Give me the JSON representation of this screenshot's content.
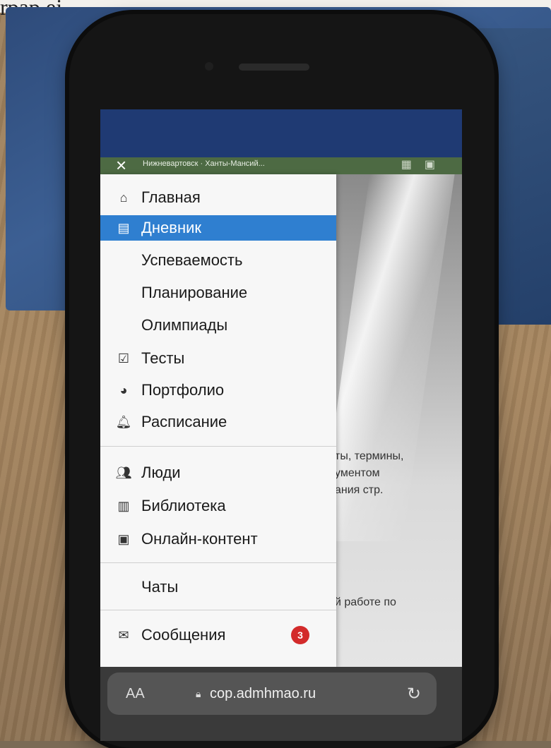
{
  "paper": {
    "text": "rpap ej"
  },
  "site_bar": {
    "title": "Нижневартовск · Ханты-Мансий..."
  },
  "menu": {
    "items": [
      {
        "label": "Главная",
        "icon": "home-icon"
      },
      {
        "label": "Дневник",
        "icon": "diary-icon",
        "active": true
      },
      {
        "label": "Успеваемость"
      },
      {
        "label": "Планирование"
      },
      {
        "label": "Олимпиады"
      },
      {
        "label": "Тесты",
        "icon": "checkbox-icon"
      },
      {
        "label": "Портфолио",
        "icon": "pie-chart-icon"
      },
      {
        "label": "Расписание",
        "icon": "bell-icon"
      },
      {
        "label": "Люди",
        "icon": "people-icon"
      },
      {
        "label": "Библиотека",
        "icon": "library-icon"
      },
      {
        "label": "Онлайн-контент",
        "icon": "online-content-icon"
      },
      {
        "label": "Чаты"
      },
      {
        "label": "Сообщения",
        "icon": "envelope-icon",
        "badge": "3"
      }
    ]
  },
  "content": {
    "lines": [
      "ты, термины,",
      "ументом",
      "ания стр."
    ],
    "line2": "й работе по"
  },
  "browser": {
    "text_size": "AA",
    "url": "cop.admhmao.ru"
  },
  "accent_color": "#2f7fd0",
  "badge_color": "#d32b2b"
}
